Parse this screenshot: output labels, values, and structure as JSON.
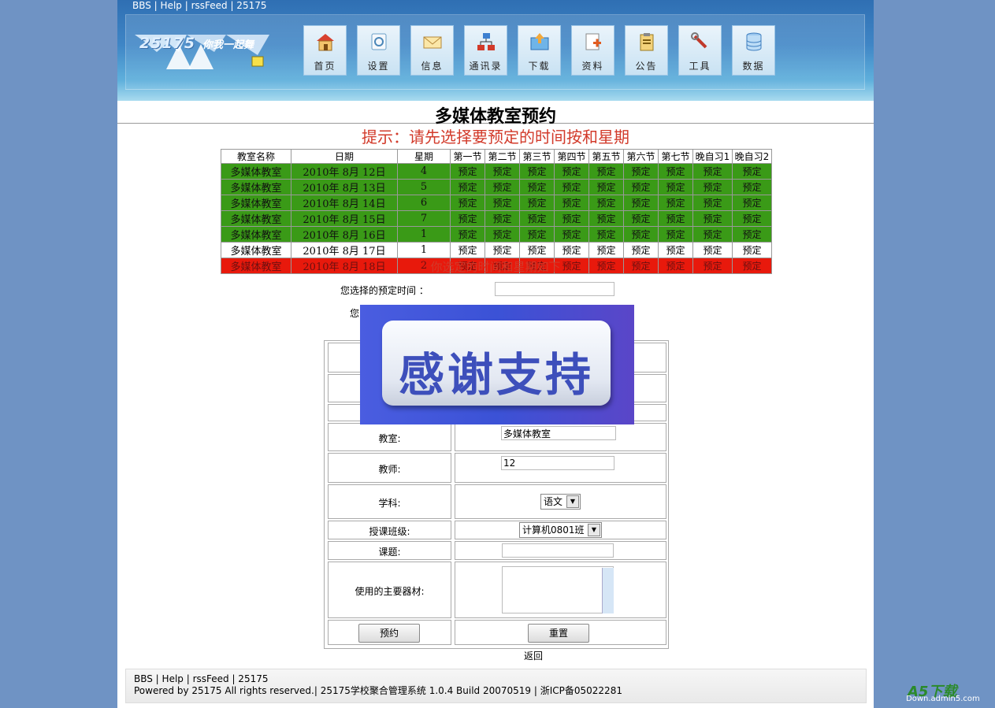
{
  "header": {
    "top_links": "BBS | Help | rssFeed | 25175",
    "logo_text": "你我一起舞",
    "logo_number": "25175",
    "nav": [
      {
        "label": "首页",
        "icon": "home-icon"
      },
      {
        "label": "设置",
        "icon": "settings-icon"
      },
      {
        "label": "信息",
        "icon": "mail-icon"
      },
      {
        "label": "通讯录",
        "icon": "network-icon"
      },
      {
        "label": "下载",
        "icon": "download-folder-icon"
      },
      {
        "label": "资料",
        "icon": "document-add-icon"
      },
      {
        "label": "公告",
        "icon": "clipboard-icon"
      },
      {
        "label": "工具",
        "icon": "wrench-icon"
      },
      {
        "label": "数据",
        "icon": "database-icon"
      }
    ]
  },
  "main": {
    "title": "多媒体教室预约",
    "hint": "提示：请先选择要预定的时间按和星期",
    "schedule": {
      "headers": [
        "教室名称",
        "日期",
        "星期",
        "第一节",
        "第二节",
        "第三节",
        "第四节",
        "第五节",
        "第六节",
        "第七节",
        "晚自习1",
        "晚自习2"
      ],
      "book_label": "预定",
      "rows": [
        {
          "room": "多媒体教室",
          "date": "2010年 8月 12日",
          "weekday": "4",
          "status": "green"
        },
        {
          "room": "多媒体教室",
          "date": "2010年 8月 13日",
          "weekday": "5",
          "status": "green"
        },
        {
          "room": "多媒体教室",
          "date": "2010年 8月 14日",
          "weekday": "6",
          "status": "green"
        },
        {
          "room": "多媒体教室",
          "date": "2010年 8月 15日",
          "weekday": "7",
          "status": "green"
        },
        {
          "room": "多媒体教室",
          "date": "2010年 8月 16日",
          "weekday": "1",
          "status": "green"
        },
        {
          "room": "多媒体教室",
          "date": "2010年 8月 17日",
          "weekday": "1",
          "status": "white"
        },
        {
          "room": "多媒体教室",
          "date": "2010年 8月 18日",
          "weekday": "2",
          "status": "red"
        }
      ]
    },
    "chosen_caption": "你选定的时间和星期如下",
    "time_label": "您选择的预定时间 ：",
    "time_value": "",
    "week_label_fragment": "您",
    "form": {
      "room_label": "教室:",
      "room_value": "多媒体教室",
      "teacher_label": "教师:",
      "teacher_value": "12",
      "subject_label": "学科:",
      "subject_value": "语文",
      "class_label": "授课班级:",
      "class_value": "计算机0801班",
      "topic_label": "课题:",
      "topic_value": "",
      "equipment_label": "使用的主要器材:",
      "equipment_value": "",
      "submit_label": "预约",
      "reset_label": "重置"
    },
    "back_label": "返回"
  },
  "overlay": {
    "text": "感谢支持"
  },
  "footer": {
    "links": "BBS | Help | rssFeed | 25175",
    "copyright": "Powered by 25175 All rights reserved.| 25175学校聚合管理系统 1.0.4 Build 20070519 | 浙ICP备05022281"
  },
  "watermark": {
    "brand": "A5下载",
    "site": "Down.admin5.com"
  },
  "colors": {
    "page_bg": "#6f93c4",
    "booked_green": "#3a9a17",
    "booked_red": "#e8190c",
    "hint_red": "#d23a2a",
    "overlay_blue": "#3b52d6"
  }
}
